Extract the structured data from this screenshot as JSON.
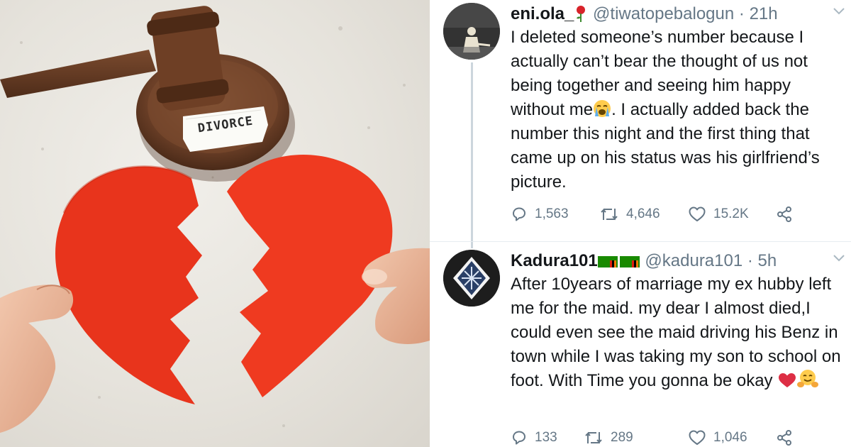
{
  "photo": {
    "paper_text": "DIVORCE"
  },
  "tweets": [
    {
      "name": "eni.ola_",
      "handle": "@tiwatopebalogun",
      "separator": "·",
      "time": "21h",
      "name_emoji": "rose-emoji",
      "text_part1": "I deleted someone’s number because I actually can’t bear the thought of us not being together and seeing him happy without me",
      "inline_emoji": "loudly-crying-face-emoji",
      "text_part2": ". I actually added back the number this night and the first thing that came up on his status was his girlfriend’s picture.",
      "replies": "1,563",
      "retweets": "4,646",
      "likes": "15.2K"
    },
    {
      "name": "Kadura101",
      "handle": "@kadura101",
      "separator": "·",
      "time": "5h",
      "name_emoji": "zambia-flag-emoji",
      "text": "After 10years of marriage my ex hubby left me for the maid. my dear I almost died,I could even see the maid driving his Benz in town while I was taking my son to school on foot. With Time you gonna be okay",
      "trailing_emojis": [
        "red-heart-emoji",
        "hugging-face-emoji"
      ],
      "replies": "133",
      "retweets": "289",
      "likes": "1,046"
    }
  ],
  "colors": {
    "text": "#14171a",
    "secondary": "#657786",
    "divider": "#e6ecf0",
    "heart_red": "#e8341c"
  },
  "icons": [
    "reply-icon",
    "retweet-icon",
    "like-icon",
    "share-icon",
    "chevron-down-icon"
  ]
}
